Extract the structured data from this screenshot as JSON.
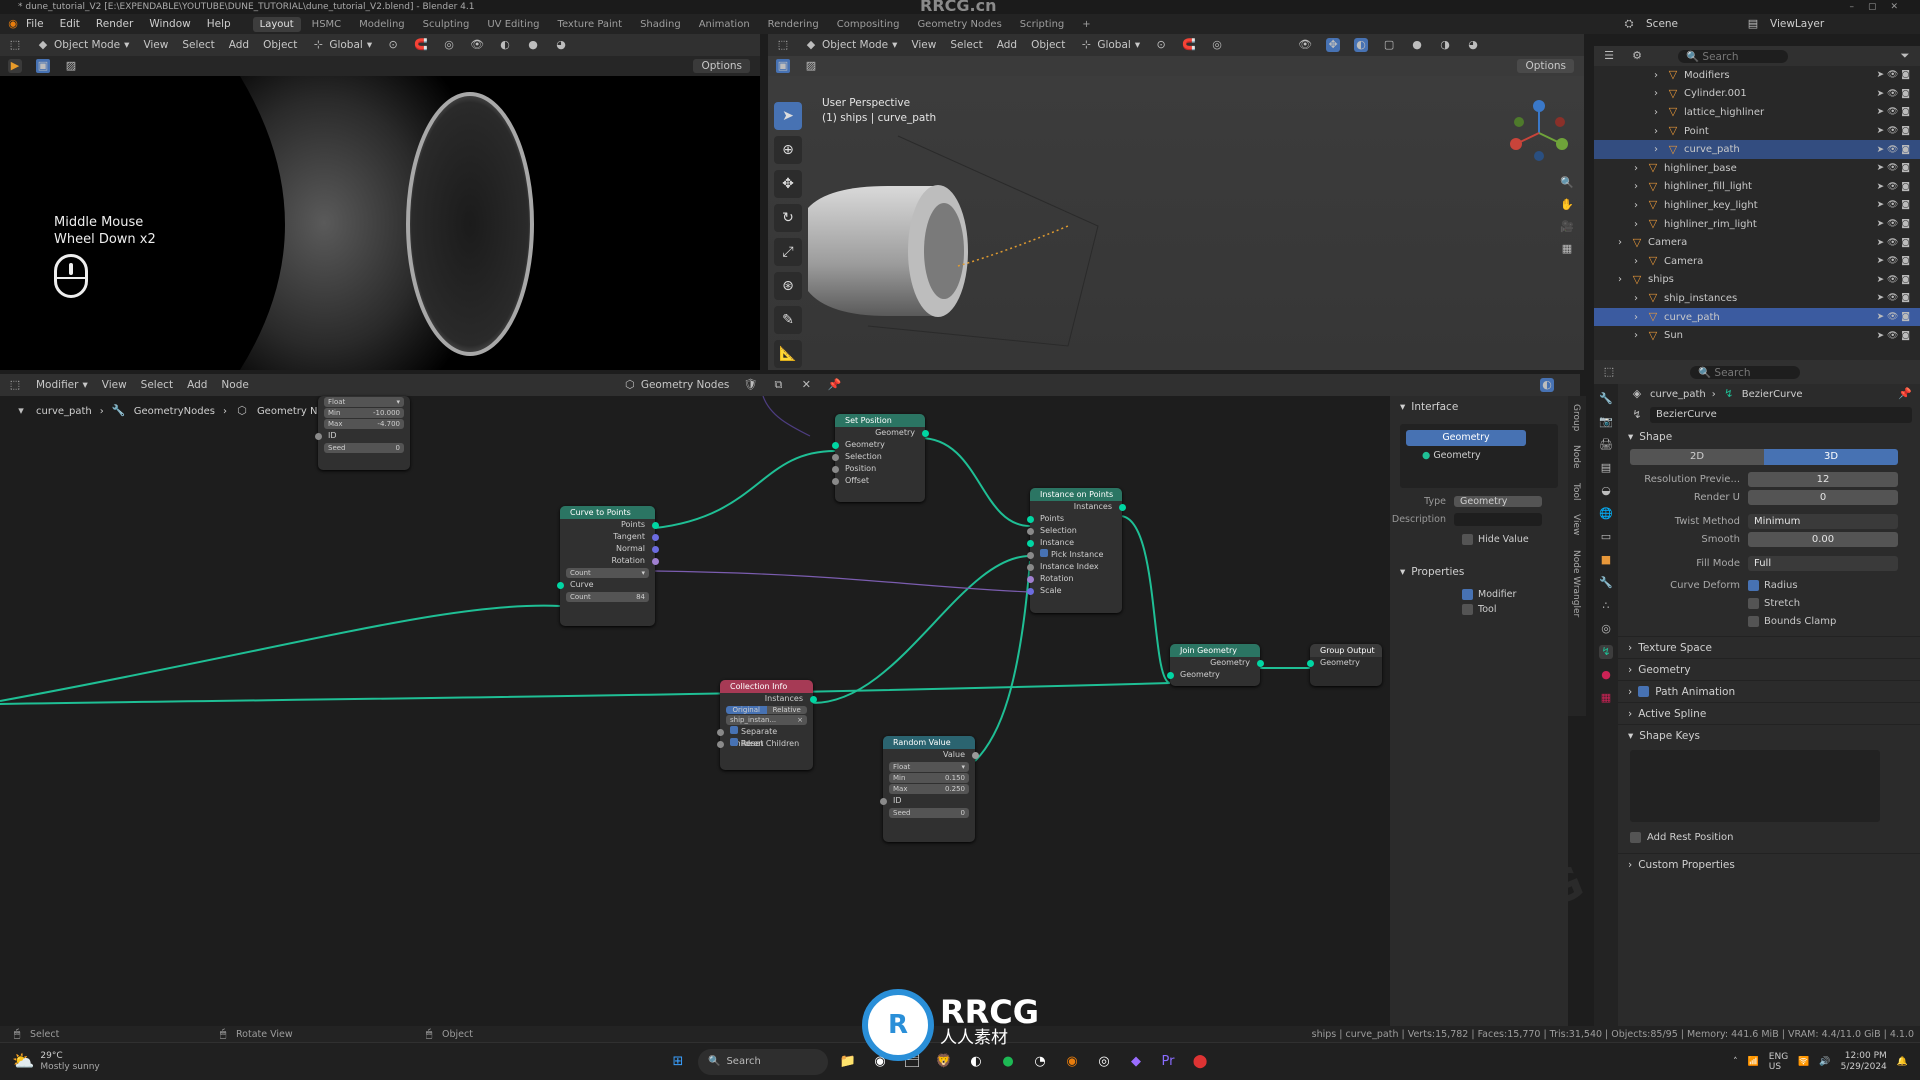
{
  "titlebar": {
    "text": "* dune_tutorial_V2 [E:\\EXPENDABLE\\YOUTUBE\\DUNE_TUTORIAL\\dune_tutorial_V2.blend] - Blender 4.1",
    "watermark": "RRCG.cn"
  },
  "menu": {
    "items": [
      "File",
      "Edit",
      "Render",
      "Window",
      "Help"
    ]
  },
  "workspaces": [
    "Layout",
    "HSMC",
    "Modeling",
    "Sculpting",
    "UV Editing",
    "Texture Paint",
    "Shading",
    "Animation",
    "Rendering",
    "Compositing",
    "Geometry Nodes",
    "Scripting"
  ],
  "workspace_active": "Layout",
  "scene": {
    "label": "Scene",
    "viewlayer": "ViewLayer"
  },
  "vp1": {
    "mode": "Object Mode",
    "view": "View",
    "select": "Select",
    "add": "Add",
    "object": "Object",
    "orientation": "Global",
    "options": "Options",
    "overlay_line1": "Middle Mouse",
    "overlay_line2": "Wheel Down x2"
  },
  "vp2": {
    "mode": "Object Mode",
    "view": "View",
    "select": "Select",
    "add": "Add",
    "object": "Object",
    "orientation": "Global",
    "options": "Options",
    "persp": "User Perspective",
    "sub": "(1) ships | curve_path"
  },
  "node_editor": {
    "editor": "Modifier",
    "view": "View",
    "select": "Select",
    "add": "Add",
    "node": "Node",
    "tree": "Geometry Nodes",
    "breadcrumb": [
      "curve_path",
      "GeometryNodes",
      "Geometry Nodes"
    ],
    "nodes": {
      "set_position": {
        "title": "Set Position",
        "out": "Geometry",
        "in": [
          "Geometry",
          "Selection",
          "Position",
          "Offset"
        ]
      },
      "curve_to_points": {
        "title": "Curve to Points",
        "out": [
          "Points",
          "Tangent",
          "Normal",
          "Rotation"
        ],
        "mode": "Count",
        "in_curve": "Curve",
        "count_label": "Count",
        "count": "84"
      },
      "instance_on_points": {
        "title": "Instance on Points",
        "out": "Instances",
        "in": [
          "Points",
          "Selection",
          "Instance",
          "Pick Instance",
          "Instance Index",
          "Rotation",
          "Scale"
        ]
      },
      "collection_info": {
        "title": "Collection Info",
        "out": "Instances",
        "opt1": "Original",
        "opt2": "Relative",
        "coll": "ship_instan...",
        "sep": "Separate Children",
        "reset": "Reset Children"
      },
      "join_geometry": {
        "title": "Join Geometry",
        "out": "Geometry",
        "in": "Geometry"
      },
      "group_output": {
        "title": "Group Output",
        "in": "Geometry"
      },
      "random_value": {
        "title": "Random Value",
        "out": "Value",
        "type": "Float",
        "min_l": "Min",
        "min": "0.150",
        "max_l": "Max",
        "max": "0.250",
        "id": "ID",
        "seed_l": "Seed",
        "seed": "0"
      },
      "random_top": {
        "type": "Float",
        "min_l": "Min",
        "min": "-10.000",
        "max_l": "Max",
        "max": "-4.700",
        "id": "ID",
        "seed_l": "Seed",
        "seed": "0"
      }
    }
  },
  "interface_panel": {
    "title": "Interface",
    "socket_out": "Geometry",
    "socket_in": "Geometry",
    "type_label": "Type",
    "type_value": "Geometry",
    "desc_label": "Description",
    "hide_value": "Hide Value",
    "properties": "Properties",
    "modifier": "Modifier",
    "tool": "Tool"
  },
  "side_tabs": [
    "Group",
    "Node",
    "Tool",
    "View",
    "Node Wrangler"
  ],
  "outliner": {
    "search": "Search",
    "rows": [
      {
        "name": "Modifiers",
        "indent": 60,
        "sel": ""
      },
      {
        "name": "Cylinder.001",
        "indent": 60,
        "sel": ""
      },
      {
        "name": "lattice_highliner",
        "indent": 60,
        "sel": ""
      },
      {
        "name": "Point",
        "indent": 60,
        "sel": ""
      },
      {
        "name": "curve_path",
        "indent": 60,
        "sel": "sel"
      },
      {
        "name": "highliner_base",
        "indent": 40,
        "sel": ""
      },
      {
        "name": "highliner_fill_light",
        "indent": 40,
        "sel": ""
      },
      {
        "name": "highliner_key_light",
        "indent": 40,
        "sel": ""
      },
      {
        "name": "highliner_rim_light",
        "indent": 40,
        "sel": ""
      },
      {
        "name": "Camera",
        "indent": 24,
        "sel": ""
      },
      {
        "name": "Camera",
        "indent": 40,
        "sel": ""
      },
      {
        "name": "ships",
        "indent": 24,
        "sel": ""
      },
      {
        "name": "ship_instances",
        "indent": 40,
        "sel": ""
      },
      {
        "name": "curve_path",
        "indent": 40,
        "sel": "sel2"
      },
      {
        "name": "Sun",
        "indent": 40,
        "sel": ""
      }
    ]
  },
  "properties": {
    "search": "Search",
    "obj": "curve_path",
    "data": "BezierCurve",
    "data_field": "BezierCurve",
    "shape": "Shape",
    "btn2d": "2D",
    "btn3d": "3D",
    "res_prev_l": "Resolution Previe...",
    "res_prev": "12",
    "render_u_l": "Render U",
    "render_u": "0",
    "twist_l": "Twist Method",
    "twist": "Minimum",
    "smooth_l": "Smooth",
    "smooth": "0.00",
    "fill_l": "Fill Mode",
    "fill": "Full",
    "deform_l": "Curve Deform",
    "radius": "Radius",
    "stretch": "Stretch",
    "bounds": "Bounds Clamp",
    "texture_space": "Texture Space",
    "geometry": "Geometry",
    "path_anim": "Path Animation",
    "active_spline": "Active Spline",
    "shape_keys": "Shape Keys",
    "add_rest": "Add Rest Position",
    "custom": "Custom Properties"
  },
  "status": {
    "select": "Select",
    "rotate": "Rotate View",
    "object": "Object",
    "stats": "ships | curve_path | Verts:15,782 | Faces:15,770 | Tris:31,540 | Objects:85/95 | Memory: 441.6 MiB | VRAM: 4.4/11.0 GiB | 4.1.0"
  },
  "taskbar": {
    "weather_temp": "29°C",
    "weather_desc": "Mostly sunny",
    "search": "Search",
    "lang": "ENG",
    "region": "US",
    "time": "12:00 PM",
    "date": "5/29/2024"
  },
  "brand": {
    "name": "RRCG",
    "sub": "人人素材"
  }
}
